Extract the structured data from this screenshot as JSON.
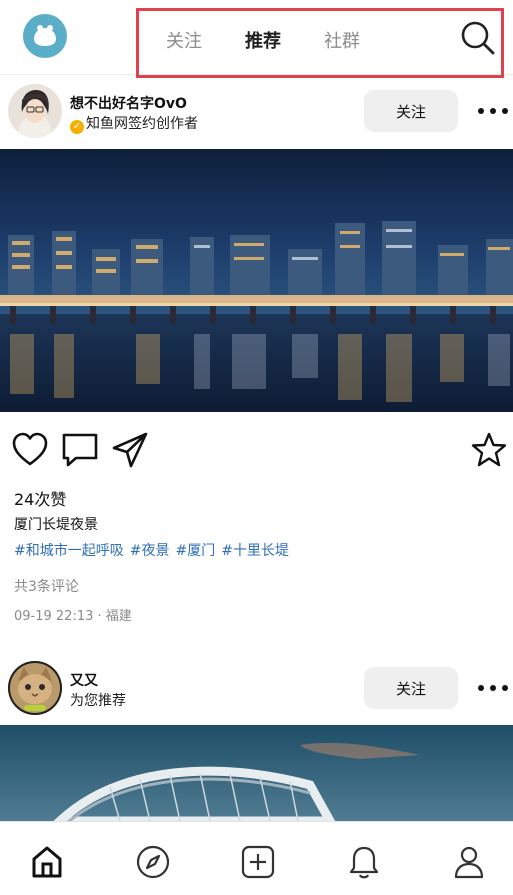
{
  "header": {
    "tabs": [
      {
        "label": "关注",
        "active": false
      },
      {
        "label": "推荐",
        "active": true
      },
      {
        "label": "社群",
        "active": false
      }
    ]
  },
  "posts": [
    {
      "username": "想不出好名字OvO",
      "subtitle": "知鱼网签约创作者",
      "verified": true,
      "follow_label": "关注",
      "likes": "24次赞",
      "caption": "厦门长堤夜景",
      "tags": [
        "#和城市一起呼吸",
        "#夜景",
        "#厦门",
        "#十里长堤"
      ],
      "comments": "共3条评论",
      "time": "09-19 22:13",
      "location": "福建"
    },
    {
      "username": "又又",
      "subtitle": "为您推荐",
      "verified": false,
      "follow_label": "关注"
    }
  ],
  "icons": {
    "logo": "fish-logo-icon",
    "search": "search-icon",
    "like": "heart-icon",
    "comment": "comment-icon",
    "share": "send-icon",
    "save": "star-icon",
    "more": "more-dots-icon"
  },
  "bottom_nav": [
    "home-icon",
    "discover-compass-icon",
    "create-plus-icon",
    "notifications-bell-icon",
    "profile-icon"
  ],
  "colors": {
    "brand": "#5aaec8",
    "highlight_box": "#e0414a",
    "tag_link": "#2f6fb8",
    "follow_button_bg": "#efefef"
  }
}
